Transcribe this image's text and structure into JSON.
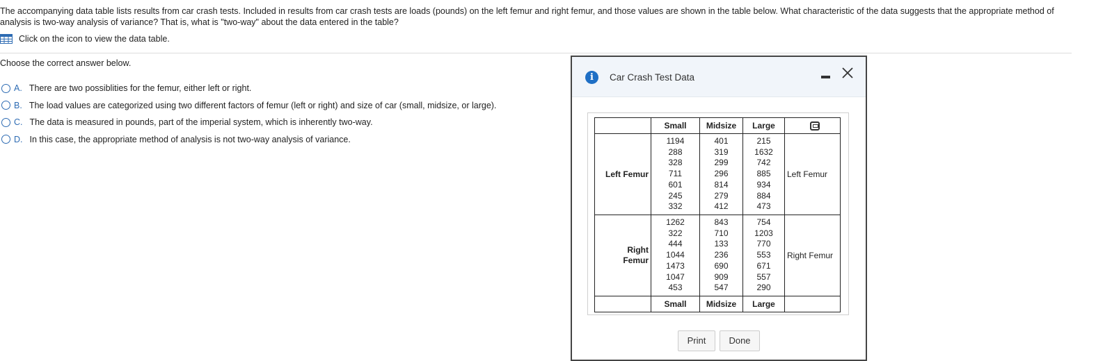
{
  "question": {
    "text": "The accompanying data table lists results from car crash tests. Included in results from car crash tests are loads (pounds) on the left femur and right femur, and those values are shown in the table below. What characteristic of the data suggests that the appropriate method of analysis is two-way analysis of variance? That is, what is \"two-way\" about the data entered in the table?",
    "data_link": "Click on the icon to view the data table."
  },
  "choose_label": "Choose the correct answer below.",
  "options": [
    {
      "letter": "A.",
      "text": "There are two possiblities for the femur, either left or right."
    },
    {
      "letter": "B.",
      "text": "The load values are categorized using two different factors of femur (left or right) and size of car (small, midsize, or large)."
    },
    {
      "letter": "C.",
      "text": "The data is measured in pounds, part of the imperial system, which is inherently two-way."
    },
    {
      "letter": "D.",
      "text": "In this case, the appropriate method of analysis is not two-way analysis of variance."
    }
  ],
  "dialog": {
    "title": "Car Crash Test Data",
    "columns": [
      "Small",
      "Midsize",
      "Large"
    ],
    "rows": [
      {
        "label": "Left Femur",
        "label_right": "Left Femur",
        "small": [
          "1194",
          "288",
          "328",
          "711",
          "601",
          "245",
          "332"
        ],
        "midsize": [
          "401",
          "319",
          "299",
          "296",
          "814",
          "279",
          "412"
        ],
        "large": [
          "215",
          "1632",
          "742",
          "885",
          "934",
          "884",
          "473"
        ]
      },
      {
        "label_line1": "Right",
        "label_line2": "Femur",
        "label_right": "Right Femur",
        "small": [
          "1262",
          "322",
          "444",
          "1044",
          "1473",
          "1047",
          "453"
        ],
        "midsize": [
          "843",
          "710",
          "133",
          "236",
          "690",
          "909",
          "547"
        ],
        "large": [
          "754",
          "1203",
          "770",
          "553",
          "671",
          "557",
          "290"
        ]
      }
    ],
    "print_label": "Print",
    "done_label": "Done"
  },
  "colors": {
    "accent": "#2d6bb3",
    "info": "#1f6fc5",
    "header_bg": "#f1f5fa"
  },
  "icons": [
    "table-icon",
    "info-icon",
    "minimize-icon",
    "close-icon",
    "copy-icon"
  ]
}
